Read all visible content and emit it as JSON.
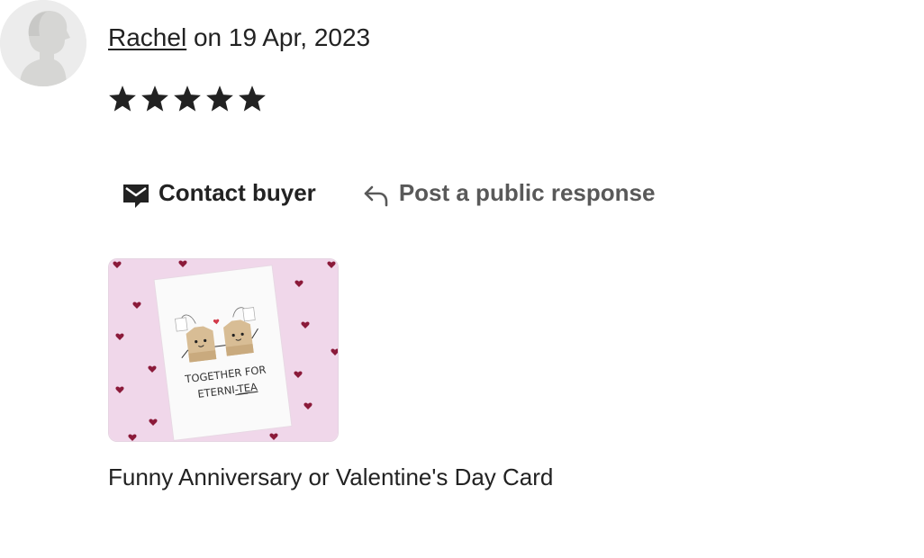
{
  "reviewer": {
    "name": "Rachel",
    "date_prefix": " on ",
    "date": "19 Apr, 2023"
  },
  "rating": {
    "stars": 5,
    "max": 5
  },
  "actions": {
    "contact_label": "Contact buyer",
    "contact_icon": "envelope-icon",
    "respond_label": "Post a public response",
    "respond_icon": "reply-arrow-icon"
  },
  "product": {
    "title": "Funny Anniversary or Valentine's Day Card",
    "image_card_line1": "TOGETHER FOR",
    "image_card_line2_prefix": "ETERNI-",
    "image_card_line2_suffix": "TEA"
  },
  "colors": {
    "text": "#222222",
    "muted": "#595959",
    "card_bg": "#f0d7ea",
    "heart": "#8b1a3a"
  }
}
